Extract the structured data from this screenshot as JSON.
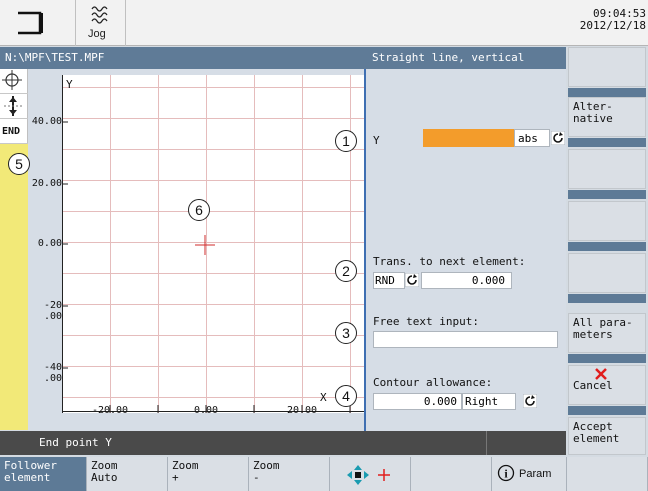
{
  "header": {
    "mode_label": "Jog",
    "time": "09:04:53",
    "date": "2012/12/18"
  },
  "pathbar": {
    "path": "N:\\MPF\\TEST.MPF",
    "title": "Straight line, vertical"
  },
  "graph": {
    "y_axis_label": "Y",
    "x_axis_label": "X",
    "y_ticks": [
      {
        "l1": "40.00",
        "l2": ""
      },
      {
        "l1": "20.00",
        "l2": ""
      },
      {
        "l1": "0.00",
        "l2": ""
      },
      {
        "l1": "-20",
        "l2": ".00"
      },
      {
        "l1": "-40",
        "l2": ".00"
      }
    ],
    "x_ticks": [
      "-20.00",
      "0.00",
      "20.00"
    ],
    "end_label": "END"
  },
  "callouts": [
    "1",
    "2",
    "3",
    "4",
    "5",
    "6"
  ],
  "form": {
    "y_label": "Y",
    "y_unit": "abs",
    "y_value": "",
    "trans_label": "Trans. to next element:",
    "trans_type": "RND",
    "trans_value": "0.000",
    "free_text_label": "Free text input:",
    "free_text_value": "",
    "contour_label": "Contour allowance:",
    "contour_value": "0.000",
    "contour_side": "Right"
  },
  "status": {
    "text": "End point Y"
  },
  "softkeys_right": [
    {
      "l1": "",
      "l2": ""
    },
    {
      "l1": "Alter-",
      "l2": "native"
    },
    {
      "l1": "",
      "l2": ""
    },
    {
      "l1": "",
      "l2": ""
    },
    {
      "l1": "",
      "l2": ""
    },
    {
      "l1": "All para-",
      "l2": "meters"
    },
    {
      "l1": "Cancel",
      "l2": ""
    },
    {
      "l1": "Accept",
      "l2": "element"
    }
  ],
  "softkeys_bottom": [
    {
      "l1": "Follower",
      "l2": "element"
    },
    {
      "l1": "Zoom",
      "l2": "Auto"
    },
    {
      "l1": "Zoom",
      "l2": "+"
    },
    {
      "l1": "Zoom",
      "l2": "-"
    },
    {
      "l1": "",
      "l2": ""
    },
    {
      "l1": "",
      "l2": ""
    },
    {
      "l1": "Param",
      "l2": ""
    },
    {
      "l1": "",
      "l2": ""
    }
  ],
  "colors": {
    "accent_blue": "#5f7b97",
    "field_orange": "#f39c2b",
    "yellow_strip": "#f2e978",
    "cancel_red": "#e11d1d"
  }
}
